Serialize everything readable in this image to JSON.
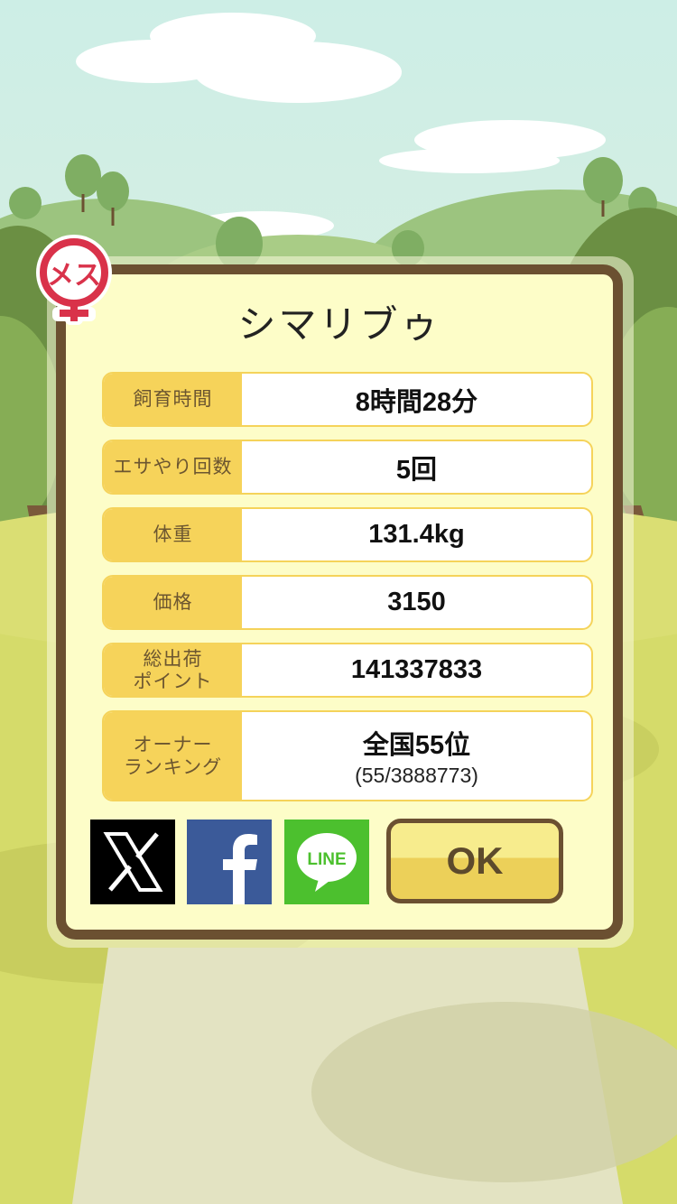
{
  "dialog": {
    "title": "シマリブゥ",
    "gender_badge": "メス",
    "stats": [
      {
        "label": "飼育時間",
        "value": "8時間28分"
      },
      {
        "label": "エサやり回数",
        "value": "5回"
      },
      {
        "label": "体重",
        "value": "131.4kg"
      },
      {
        "label": "価格",
        "value": "3150"
      },
      {
        "label_line1": "総出荷",
        "label_line2": "ポイント",
        "value": "141337833"
      },
      {
        "label_line1": "オーナー",
        "label_line2": "ランキング",
        "value": "全国55位",
        "sub_value": "(55/3888773)"
      }
    ],
    "share": {
      "x_icon": "x-logo-icon",
      "facebook_icon": "facebook-logo-icon",
      "line_icon": "line-logo-icon",
      "line_text": "LINE"
    },
    "ok_label": "OK"
  },
  "colors": {
    "dialog_border": "#6b5031",
    "dialog_bg": "#fdfdc8",
    "label_bg": "#f6d35a",
    "badge_red": "#d9324a",
    "facebook_blue": "#3b5a99",
    "line_green": "#4cc02e"
  }
}
